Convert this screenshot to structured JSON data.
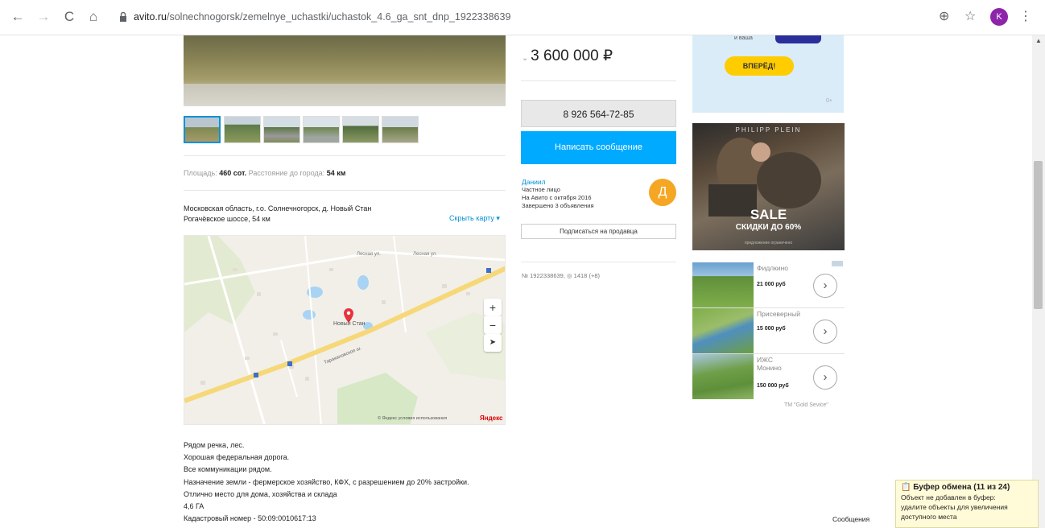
{
  "browser": {
    "url_domain": "avito.ru",
    "url_path": "/solnechnogorsk/zemelnye_uchastki/uchastok_4.6_ga_snt_dnp_1922338639",
    "profile_initial": "K",
    "back_icon": "←",
    "forward_icon": "→",
    "reload_icon": "C",
    "home_icon": "⌂",
    "zoom_icon": "⊕",
    "star_icon": "☆",
    "menu_icon": "⋮"
  },
  "listing": {
    "params": {
      "area_label": "Площадь:",
      "area_value": "460 сот.",
      "distance_label": "Расстояние до города:",
      "distance_value": "54 км"
    },
    "address_line1": "Московская область, г.о. Солнечногорск, д. Новый Стан",
    "address_line2": "Рогачёвское шоссе, 54 км",
    "hide_map": "Скрыть карту",
    "map": {
      "place_name": "Новый Стан",
      "road_name": "Таракановское ш.",
      "street1": "Лесная ул.",
      "street2": "Лесная ул.",
      "zoom_in": "+",
      "zoom_out": "−",
      "locate": "➤",
      "copyright": "© Яндекс условия использования",
      "brand": "Яндекс"
    },
    "description": [
      "Рядом речка, лес.",
      "Хорошая федеральная дорога.",
      "Все коммуникации рядом.",
      "Назначение земли - фермерское хозяйство, КФХ, с разрешением до 20% застройки.",
      "Отлично место для дома, хозяйства и склада",
      "4,6 ГА",
      "Кадастровый номер - 50:09:0010617:13"
    ]
  },
  "sidebar": {
    "price": "3 600 000 ₽",
    "phone": "8 926 564-72-85",
    "message_button": "Написать сообщение",
    "seller": {
      "name": "Даниил",
      "type": "Частное лицо",
      "since": "На Авито с октября 2016",
      "completed": "Завершено 3 объявления",
      "avatar_letter": "Д"
    },
    "subscribe_button": "Подписаться на продавца",
    "item_id": "№ 1922338639,",
    "views": "1418 (+8)"
  },
  "ads": {
    "ad1_small": "и ваша",
    "ad1_button": "ВПЕРЁД!",
    "ad1_badge": "0+",
    "ad2_brand": "PHILIPP PLEIN",
    "ad2_sale": "SALE",
    "ad2_discount": "СКИДКИ ДО 60%",
    "ad2_note": "предложение ограничено",
    "listings": [
      {
        "title": "Фидлкино",
        "price": "21 000 руб"
      },
      {
        "title": "Присеверный",
        "price": "15 000 руб"
      },
      {
        "title_line1": "ИЖС",
        "title_line2": "Монино",
        "price": "150 000 руб"
      }
    ],
    "credit": "TM \"Gold Sevice\""
  },
  "clipboard": {
    "title": "Буфер обмена (11 из 24)",
    "line1": "Объект не добавлен в буфер:",
    "line2": "удалите объекты для увеличения",
    "line3": "доступного места"
  },
  "messages_tab": "Сообщения"
}
